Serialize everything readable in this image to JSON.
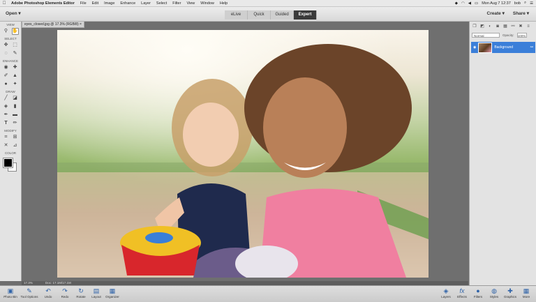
{
  "mac_menubar": {
    "apple": "",
    "app_name": "Adobe Photoshop Elements Editor",
    "menus": [
      "File",
      "Edit",
      "Image",
      "Enhance",
      "Layer",
      "Select",
      "Filter",
      "View",
      "Window",
      "Help"
    ],
    "datetime": "Mon Aug 7  12:37",
    "user": "bob"
  },
  "topbar": {
    "open": "Open ▾",
    "modes": [
      "eLive",
      "Quick",
      "Guided",
      "Expert"
    ],
    "active_mode": "Expert",
    "create": "Create ▾",
    "share": "Share ▾"
  },
  "toolbox": {
    "sections": [
      "VIEW",
      "SELECT",
      "ENHANCE",
      "DRAW",
      "MODIFY",
      "COLOR"
    ],
    "tools": {
      "view": [
        "zoom-icon",
        "hand-icon"
      ],
      "select": [
        "move-icon",
        "marquee-icon",
        "lasso-icon",
        "quick-selection-icon"
      ],
      "enhance": [
        "red-eye-icon",
        "spot-healing-icon",
        "smart-brush-icon",
        "clone-stamp-icon",
        "blur-icon",
        "sponge-icon"
      ],
      "draw": [
        "brush-icon",
        "eraser-icon",
        "paint-bucket-icon",
        "gradient-icon",
        "color-picker-icon",
        "shape-icon",
        "type-icon",
        "pencil-icon"
      ],
      "modify": [
        "crop-icon",
        "recompose-icon",
        "content-aware-move-icon",
        "straighten-icon"
      ]
    },
    "foreground_color": "#000000",
    "background_color": "#ffffff"
  },
  "document": {
    "tab_title": "eyes_closed.jpg @ 17.3% (RGB/8) ×",
    "zoom": "17.3%",
    "doc_info": "Doc: 17.1M/17.1M"
  },
  "layers_panel": {
    "blend_mode": "Normal",
    "opacity_label": "Opacity:",
    "opacity_value": "100%",
    "layer_name": "Background"
  },
  "bottom_bar": {
    "left": [
      "Photo Bin",
      "Tool Options",
      "Undo",
      "Redo",
      "Rotate",
      "Layout",
      "Organizer"
    ],
    "right": [
      "Layers",
      "Effects",
      "Filters",
      "Styles",
      "Graphics",
      "More"
    ]
  },
  "colors": {
    "accent_blue": "#3b7fd9",
    "active_tab": "#3a3a3a"
  }
}
